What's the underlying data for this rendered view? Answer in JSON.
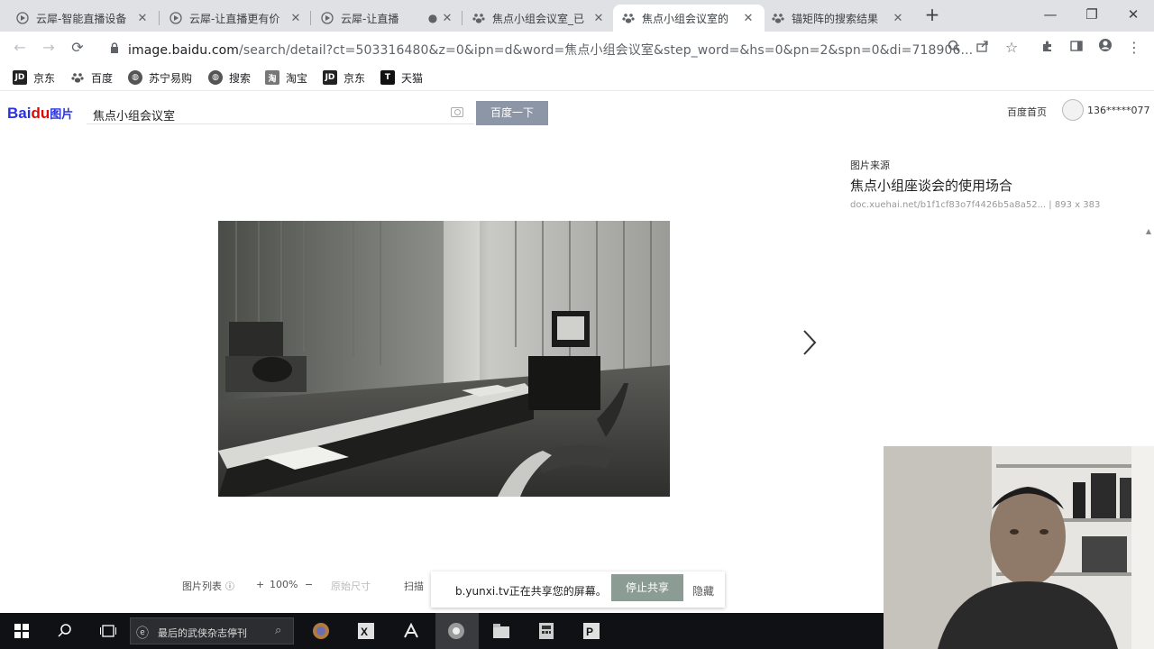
{
  "browser": {
    "tabs": [
      {
        "title": "云犀-智能直播设备",
        "favicon": "yunxi-icon"
      },
      {
        "title": "云犀-让直播更有价",
        "favicon": "yunxi-icon"
      },
      {
        "title": "云犀-让直播",
        "favicon": "yunxi-icon"
      },
      {
        "title": "焦点小组会议室_已",
        "favicon": "baidu-paw-icon"
      },
      {
        "title": "焦点小组会议室的",
        "favicon": "baidu-paw-icon",
        "active": true
      },
      {
        "title": "锚矩阵的搜索结果",
        "favicon": "baidu-paw-icon"
      }
    ],
    "new_tab": "+",
    "url_host": "image.baidu.com",
    "url_path": "/search/detail?ct=503316480&z=0&ipn=d&word=焦点小组会议室&step_word=&hs=0&pn=2&spn=0&di=718906...",
    "bookmarks": [
      {
        "label": "京东",
        "icon": "jd-icon",
        "color": "#222"
      },
      {
        "label": "百度",
        "icon": "baidu-paw-icon",
        "color": "#666"
      },
      {
        "label": "苏宁易购",
        "icon": "globe-icon",
        "color": "#555"
      },
      {
        "label": "搜索",
        "icon": "globe-icon",
        "color": "#555"
      },
      {
        "label": "淘宝",
        "icon": "taobao-icon",
        "color": "#777"
      },
      {
        "label": "京东",
        "icon": "jd-icon",
        "color": "#222"
      },
      {
        "label": "天猫",
        "icon": "tmall-icon",
        "color": "#111"
      }
    ]
  },
  "page": {
    "logo_bai": "Bai",
    "logo_du": "du",
    "logo_suffix": "图片",
    "search_query": "焦点小组会议室",
    "search_button": "百度一下",
    "home_link": "百度首页",
    "username": "136*****077",
    "source_label": "图片来源",
    "source_title": "焦点小组座谈会的使用场合",
    "source_meta": "doc.xuehai.net/b1f1cf83o7f4426b5a8a52... | 893 x 383",
    "toolbar": {
      "list": "图片列表",
      "zoom": "100%",
      "plus": "+",
      "minus": "−",
      "fit": "原始尺寸",
      "scan": "扫描"
    }
  },
  "share_bar": {
    "message": "b.yunxi.tv正在共享您的屏幕。",
    "stop_button": "停止共享",
    "hide_button": "隐藏"
  },
  "taskbar": {
    "search_text": "最后的武侠杂志停刊"
  }
}
